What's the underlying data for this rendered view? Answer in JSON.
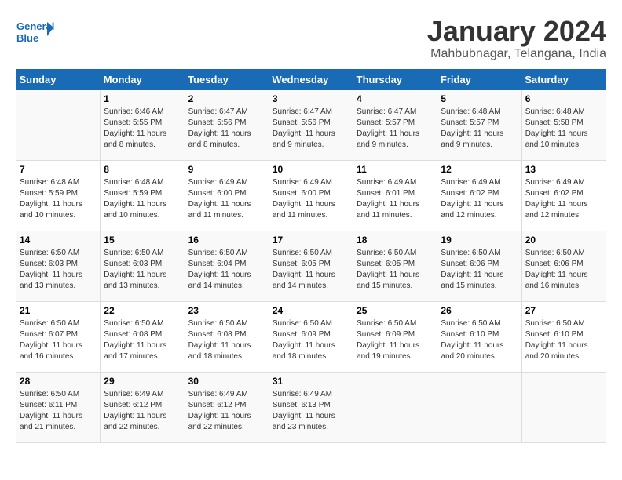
{
  "header": {
    "logo_line1": "General",
    "logo_line2": "Blue",
    "month_title": "January 2024",
    "location": "Mahbubnagar, Telangana, India"
  },
  "days_of_week": [
    "Sunday",
    "Monday",
    "Tuesday",
    "Wednesday",
    "Thursday",
    "Friday",
    "Saturday"
  ],
  "weeks": [
    [
      {
        "num": "",
        "info": ""
      },
      {
        "num": "1",
        "info": "Sunrise: 6:46 AM\nSunset: 5:55 PM\nDaylight: 11 hours\nand 8 minutes."
      },
      {
        "num": "2",
        "info": "Sunrise: 6:47 AM\nSunset: 5:56 PM\nDaylight: 11 hours\nand 8 minutes."
      },
      {
        "num": "3",
        "info": "Sunrise: 6:47 AM\nSunset: 5:56 PM\nDaylight: 11 hours\nand 9 minutes."
      },
      {
        "num": "4",
        "info": "Sunrise: 6:47 AM\nSunset: 5:57 PM\nDaylight: 11 hours\nand 9 minutes."
      },
      {
        "num": "5",
        "info": "Sunrise: 6:48 AM\nSunset: 5:57 PM\nDaylight: 11 hours\nand 9 minutes."
      },
      {
        "num": "6",
        "info": "Sunrise: 6:48 AM\nSunset: 5:58 PM\nDaylight: 11 hours\nand 10 minutes."
      }
    ],
    [
      {
        "num": "7",
        "info": "Sunrise: 6:48 AM\nSunset: 5:59 PM\nDaylight: 11 hours\nand 10 minutes."
      },
      {
        "num": "8",
        "info": "Sunrise: 6:48 AM\nSunset: 5:59 PM\nDaylight: 11 hours\nand 10 minutes."
      },
      {
        "num": "9",
        "info": "Sunrise: 6:49 AM\nSunset: 6:00 PM\nDaylight: 11 hours\nand 11 minutes."
      },
      {
        "num": "10",
        "info": "Sunrise: 6:49 AM\nSunset: 6:00 PM\nDaylight: 11 hours\nand 11 minutes."
      },
      {
        "num": "11",
        "info": "Sunrise: 6:49 AM\nSunset: 6:01 PM\nDaylight: 11 hours\nand 11 minutes."
      },
      {
        "num": "12",
        "info": "Sunrise: 6:49 AM\nSunset: 6:02 PM\nDaylight: 11 hours\nand 12 minutes."
      },
      {
        "num": "13",
        "info": "Sunrise: 6:49 AM\nSunset: 6:02 PM\nDaylight: 11 hours\nand 12 minutes."
      }
    ],
    [
      {
        "num": "14",
        "info": "Sunrise: 6:50 AM\nSunset: 6:03 PM\nDaylight: 11 hours\nand 13 minutes."
      },
      {
        "num": "15",
        "info": "Sunrise: 6:50 AM\nSunset: 6:03 PM\nDaylight: 11 hours\nand 13 minutes."
      },
      {
        "num": "16",
        "info": "Sunrise: 6:50 AM\nSunset: 6:04 PM\nDaylight: 11 hours\nand 14 minutes."
      },
      {
        "num": "17",
        "info": "Sunrise: 6:50 AM\nSunset: 6:05 PM\nDaylight: 11 hours\nand 14 minutes."
      },
      {
        "num": "18",
        "info": "Sunrise: 6:50 AM\nSunset: 6:05 PM\nDaylight: 11 hours\nand 15 minutes."
      },
      {
        "num": "19",
        "info": "Sunrise: 6:50 AM\nSunset: 6:06 PM\nDaylight: 11 hours\nand 15 minutes."
      },
      {
        "num": "20",
        "info": "Sunrise: 6:50 AM\nSunset: 6:06 PM\nDaylight: 11 hours\nand 16 minutes."
      }
    ],
    [
      {
        "num": "21",
        "info": "Sunrise: 6:50 AM\nSunset: 6:07 PM\nDaylight: 11 hours\nand 16 minutes."
      },
      {
        "num": "22",
        "info": "Sunrise: 6:50 AM\nSunset: 6:08 PM\nDaylight: 11 hours\nand 17 minutes."
      },
      {
        "num": "23",
        "info": "Sunrise: 6:50 AM\nSunset: 6:08 PM\nDaylight: 11 hours\nand 18 minutes."
      },
      {
        "num": "24",
        "info": "Sunrise: 6:50 AM\nSunset: 6:09 PM\nDaylight: 11 hours\nand 18 minutes."
      },
      {
        "num": "25",
        "info": "Sunrise: 6:50 AM\nSunset: 6:09 PM\nDaylight: 11 hours\nand 19 minutes."
      },
      {
        "num": "26",
        "info": "Sunrise: 6:50 AM\nSunset: 6:10 PM\nDaylight: 11 hours\nand 20 minutes."
      },
      {
        "num": "27",
        "info": "Sunrise: 6:50 AM\nSunset: 6:10 PM\nDaylight: 11 hours\nand 20 minutes."
      }
    ],
    [
      {
        "num": "28",
        "info": "Sunrise: 6:50 AM\nSunset: 6:11 PM\nDaylight: 11 hours\nand 21 minutes."
      },
      {
        "num": "29",
        "info": "Sunrise: 6:49 AM\nSunset: 6:12 PM\nDaylight: 11 hours\nand 22 minutes."
      },
      {
        "num": "30",
        "info": "Sunrise: 6:49 AM\nSunset: 6:12 PM\nDaylight: 11 hours\nand 22 minutes."
      },
      {
        "num": "31",
        "info": "Sunrise: 6:49 AM\nSunset: 6:13 PM\nDaylight: 11 hours\nand 23 minutes."
      },
      {
        "num": "",
        "info": ""
      },
      {
        "num": "",
        "info": ""
      },
      {
        "num": "",
        "info": ""
      }
    ]
  ]
}
